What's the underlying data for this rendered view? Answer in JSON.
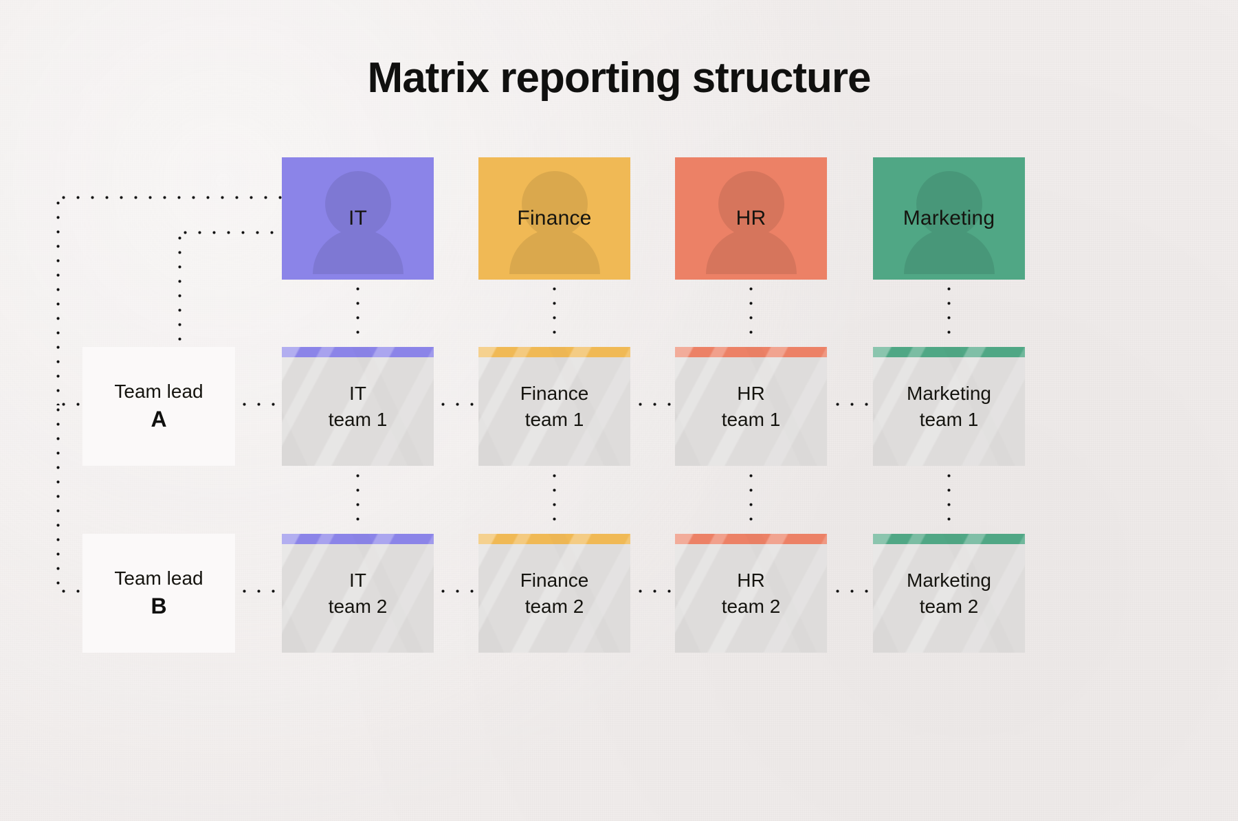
{
  "title": "Matrix reporting structure",
  "theme": {
    "background": "#f1edec",
    "text": "#15140f",
    "team_box": "#dedcdb",
    "lead_box": "#fbf9f9",
    "connector": "#111111"
  },
  "departments": [
    {
      "name": "IT",
      "color": "#8b84e8"
    },
    {
      "name": "Finance",
      "color": "#f0b955"
    },
    {
      "name": "HR",
      "color": "#ec8166"
    },
    {
      "name": "Marketing",
      "color": "#50a785"
    }
  ],
  "team_leads": [
    {
      "title": "Team lead",
      "letter": "A"
    },
    {
      "title": "Team lead",
      "letter": "B"
    }
  ],
  "teams": [
    [
      {
        "dept": "IT",
        "team": "team 1",
        "color": "#8b84e8"
      },
      {
        "dept": "Finance",
        "team": "team 1",
        "color": "#f0b955"
      },
      {
        "dept": "HR",
        "team": "team 1",
        "color": "#ec8166"
      },
      {
        "dept": "Marketing",
        "team": "team 1",
        "color": "#50a785"
      }
    ],
    [
      {
        "dept": "IT",
        "team": "team 2",
        "color": "#8b84e8"
      },
      {
        "dept": "Finance",
        "team": "team 2",
        "color": "#f0b955"
      },
      {
        "dept": "HR",
        "team": "team 2",
        "color": "#ec8166"
      },
      {
        "dept": "Marketing",
        "team": "team 2",
        "color": "#50a785"
      }
    ]
  ]
}
